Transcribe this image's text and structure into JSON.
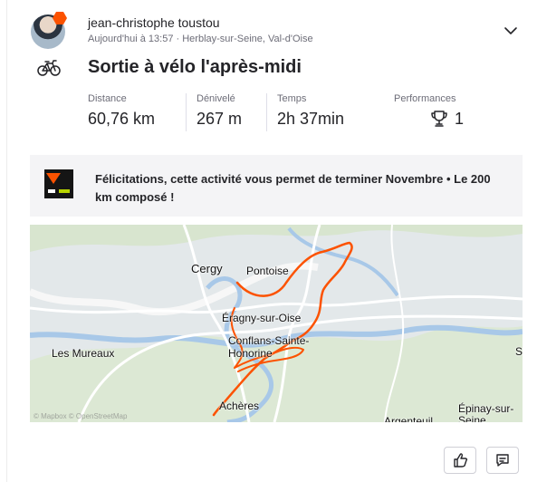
{
  "athlete": {
    "name": "jean-christophe toustou",
    "meta": "Aujourd'hui à 13:57 · Herblay-sur-Seine, Val-d'Oise",
    "avatar_icon": "user-photo-with-strava-badge"
  },
  "activity": {
    "type_icon": "bike-icon",
    "title": "Sortie à vélo l'après-midi"
  },
  "stats": [
    {
      "label": "Distance",
      "value": "60,76 km"
    },
    {
      "label": "Dénivelé",
      "value": "267 m"
    },
    {
      "label": "Temps",
      "value": "2h 37min"
    },
    {
      "label": "Performances",
      "value": "1"
    }
  ],
  "notice": {
    "text": "Félicitations, cette activité vous permet de terminer Novembre • Le 200 km composé !",
    "logo_icon": "challenge-badge-icon"
  },
  "map": {
    "labels": [
      "Cergy",
      "Pontoise",
      "Éragny-sur-Oise",
      "Conflans-Sainte-Honorine",
      "Les Mureaux",
      "Achères",
      "Épinay-sur-Seine",
      "Argenteuil",
      "S"
    ],
    "attribution": "© Mapbox © OpenStreetMap",
    "route_color": "#fc5200",
    "river_color": "#a8c8e8"
  },
  "actions": [
    {
      "label": "kudos",
      "icon": "thumbs-up-icon"
    },
    {
      "label": "comment",
      "icon": "comment-icon"
    }
  ],
  "colors": {
    "brand": "#fc5200",
    "text": "#242428",
    "muted": "#6d6d78",
    "notice_bg": "#f4f4f6"
  }
}
